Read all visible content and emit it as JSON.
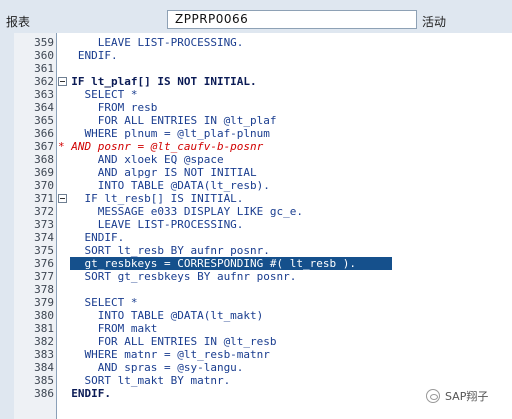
{
  "toolbar": {
    "left_label": "报表",
    "program_name": "ZPPRP0066",
    "right_label": "活动"
  },
  "editor": {
    "highlight_line": "376",
    "lines": [
      {
        "n": "359",
        "t": "      LEAVE LIST-PROCESSING."
      },
      {
        "n": "360",
        "t": "   ENDIF."
      },
      {
        "n": "361",
        "t": ""
      },
      {
        "n": "362",
        "t": "  IF lt_plaf[] IS NOT INITIAL."
      },
      {
        "n": "363",
        "t": "    SELECT *"
      },
      {
        "n": "364",
        "t": "      FROM resb"
      },
      {
        "n": "365",
        "t": "      FOR ALL ENTRIES IN @lt_plaf"
      },
      {
        "n": "366",
        "t": "    WHERE plnum = @lt_plaf-plnum"
      },
      {
        "n": "367",
        "t": "* AND posnr = @lt_caufv-b-posnr"
      },
      {
        "n": "368",
        "t": "      AND xloek EQ @space"
      },
      {
        "n": "369",
        "t": "      AND alpgr IS NOT INITIAL"
      },
      {
        "n": "370",
        "t": "      INTO TABLE @DATA(lt_resb)."
      },
      {
        "n": "371",
        "t": "    IF lt_resb[] IS INITIAL."
      },
      {
        "n": "372",
        "t": "      MESSAGE e033 DISPLAY LIKE gc_e."
      },
      {
        "n": "373",
        "t": "      LEAVE LIST-PROCESSING."
      },
      {
        "n": "374",
        "t": "    ENDIF."
      },
      {
        "n": "375",
        "t": "    SORT lt_resb BY aufnr posnr."
      },
      {
        "n": "376",
        "t": "    gt_resbkeys = CORRESPONDING #( lt_resb )."
      },
      {
        "n": "377",
        "t": "    SORT gt_resbkeys BY aufnr posnr."
      },
      {
        "n": "378",
        "t": ""
      },
      {
        "n": "379",
        "t": "    SELECT *"
      },
      {
        "n": "380",
        "t": "      INTO TABLE @DATA(lt_makt)"
      },
      {
        "n": "381",
        "t": "      FROM makt"
      },
      {
        "n": "382",
        "t": "      FOR ALL ENTRIES IN @lt_resb"
      },
      {
        "n": "383",
        "t": "    WHERE matnr = @lt_resb-matnr"
      },
      {
        "n": "384",
        "t": "      AND spras = @sy-langu."
      },
      {
        "n": "385",
        "t": "    SORT lt_makt BY matnr."
      },
      {
        "n": "386",
        "t": "  ENDIF."
      }
    ]
  },
  "watermark": {
    "text": "SAP翔子",
    "icon": "wechat-icon"
  }
}
